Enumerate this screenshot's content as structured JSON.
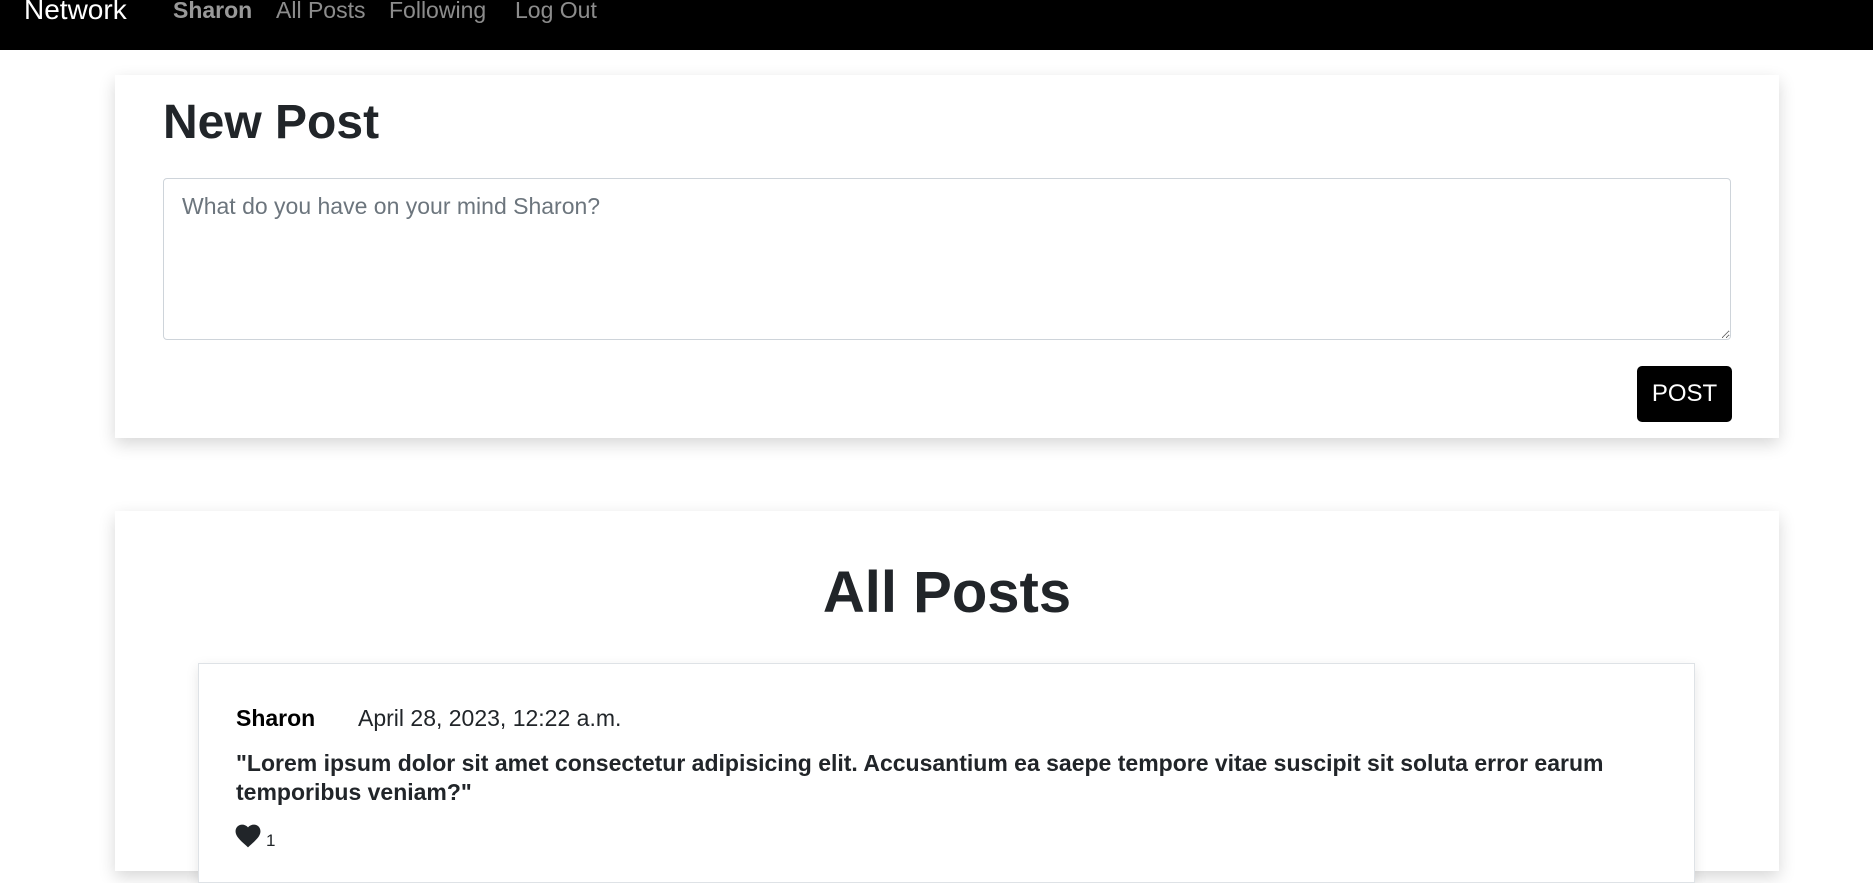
{
  "nav": {
    "brand": "Network",
    "user": "Sharon",
    "all_posts": "All Posts",
    "following": "Following",
    "logout": "Log Out"
  },
  "new_post": {
    "title": "New Post",
    "placeholder": "What do you have on your mind Sharon?",
    "value": "",
    "button_label": "POST"
  },
  "all_posts": {
    "title": "All Posts",
    "posts": [
      {
        "author": "Sharon",
        "date": "April 28, 2023, 12:22 a.m.",
        "content": "\"Lorem ipsum dolor sit amet consectetur adipisicing elit. Accusantium ea saepe tempore vitae suscipit sit soluta error earum temporibus veniam?\"",
        "likes": "1",
        "like_icon": "heart-icon"
      }
    ]
  },
  "colors": {
    "navbar_bg": "#000000",
    "button_bg": "#000000",
    "text": "#212529"
  }
}
